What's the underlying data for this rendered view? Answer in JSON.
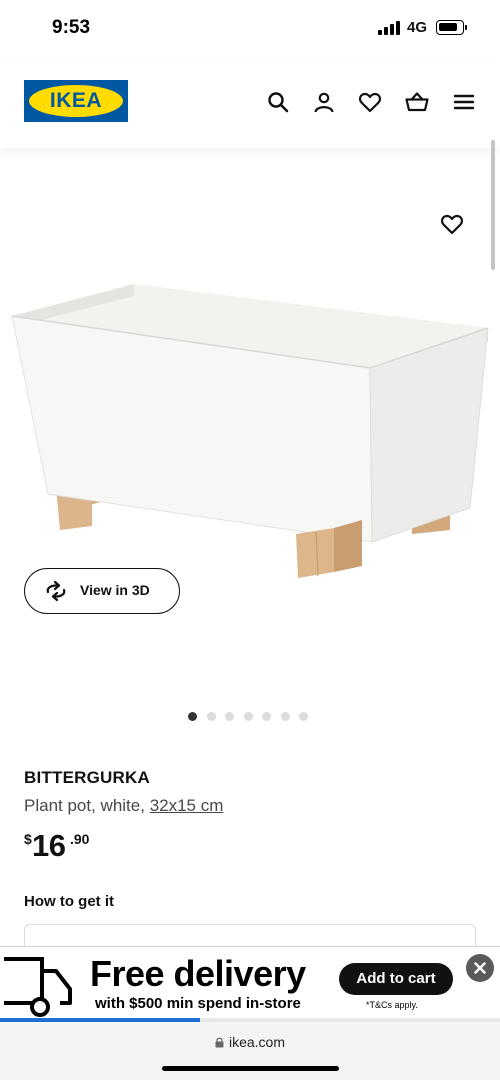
{
  "status_bar": {
    "time": "9:53",
    "network": "4G",
    "battery_level": 0.85
  },
  "header": {
    "logo_text": "IKEA",
    "icons": [
      "search-icon",
      "user-icon",
      "heart-icon",
      "basket-icon",
      "menu-icon"
    ]
  },
  "gallery": {
    "view3d_label": "View in 3D",
    "image_count": 7,
    "active_index": 0
  },
  "product": {
    "name": "BITTERGURKA",
    "description": "Plant pot, white, ",
    "size": "32x15 cm",
    "price_currency": "$",
    "price_integer": "16",
    "price_decimal": ".90"
  },
  "how_to_get": {
    "label": "How to get it"
  },
  "banner": {
    "title": "Free delivery",
    "subtitle": "with $500 min spend in-store",
    "cta": "Add to cart",
    "terms": "*T&Cs apply.",
    "progress": 0.4
  },
  "browser": {
    "url": "ikea.com"
  },
  "colors": {
    "ikea_blue": "#0058a3",
    "ikea_yellow": "#ffdb00",
    "progress_blue": "#1d6fd6"
  }
}
